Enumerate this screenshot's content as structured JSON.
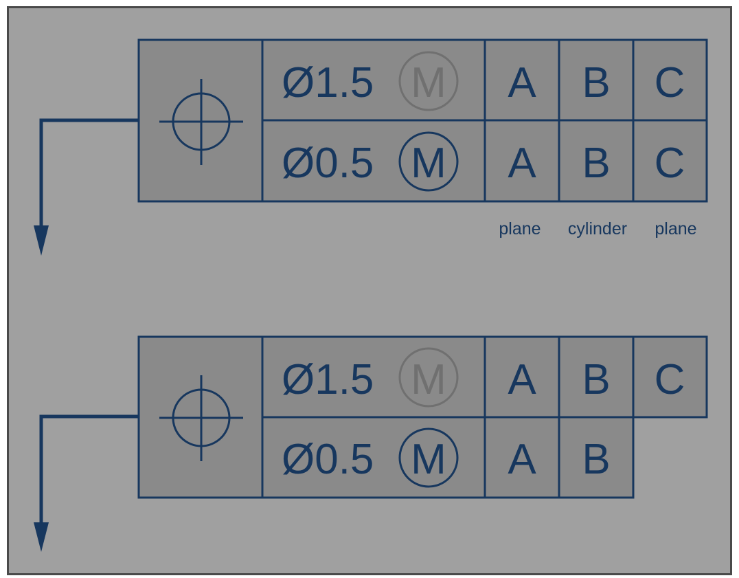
{
  "colors": {
    "panel_background": "#a0a0a0",
    "cell_fill": "#8a8a8a",
    "line": "#17375e",
    "ghost_modifier": "#707070"
  },
  "frames": [
    {
      "symbol": "position-icon",
      "upper_row": {
        "tolerance": "Ø1.5",
        "modifier": "M",
        "modifier_state": "ghosted",
        "datums": [
          "A",
          "B",
          "C"
        ]
      },
      "lower_row": {
        "tolerance": "Ø0.5",
        "modifier": "M",
        "modifier_state": "active",
        "datums": [
          "A",
          "B",
          "C"
        ]
      },
      "datum_notes": [
        "plane",
        "cylinder",
        "plane"
      ]
    },
    {
      "symbol": "position-icon",
      "upper_row": {
        "tolerance": "Ø1.5",
        "modifier": "M",
        "modifier_state": "ghosted",
        "datums": [
          "A",
          "B",
          "C"
        ]
      },
      "lower_row": {
        "tolerance": "Ø0.5",
        "modifier": "M",
        "modifier_state": "active",
        "datums": [
          "A",
          "B"
        ]
      },
      "datum_notes": []
    }
  ]
}
